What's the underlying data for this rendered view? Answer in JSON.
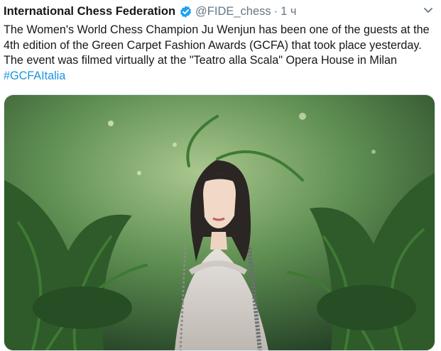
{
  "tweet": {
    "display_name": "International Chess Federation",
    "handle": "@FIDE_chess",
    "separator": "·",
    "time": "1 ч",
    "text": "The Women's World Chess Champion Ju Wenjun has been one of the guests at the 4th edition of the Green Carpet Fashion Awards (GCFA) that took place yesterday. The event was filmed virtually at the \"Teatro alla Scala\" Opera House in Milan ",
    "hashtag": "#GCFAItalia",
    "icons": {
      "verified": "verified-badge-icon",
      "menu": "chevron-down-icon"
    },
    "colors": {
      "link": "#1b95e0",
      "verified": "#1da1f2",
      "muted": "#657786"
    }
  }
}
